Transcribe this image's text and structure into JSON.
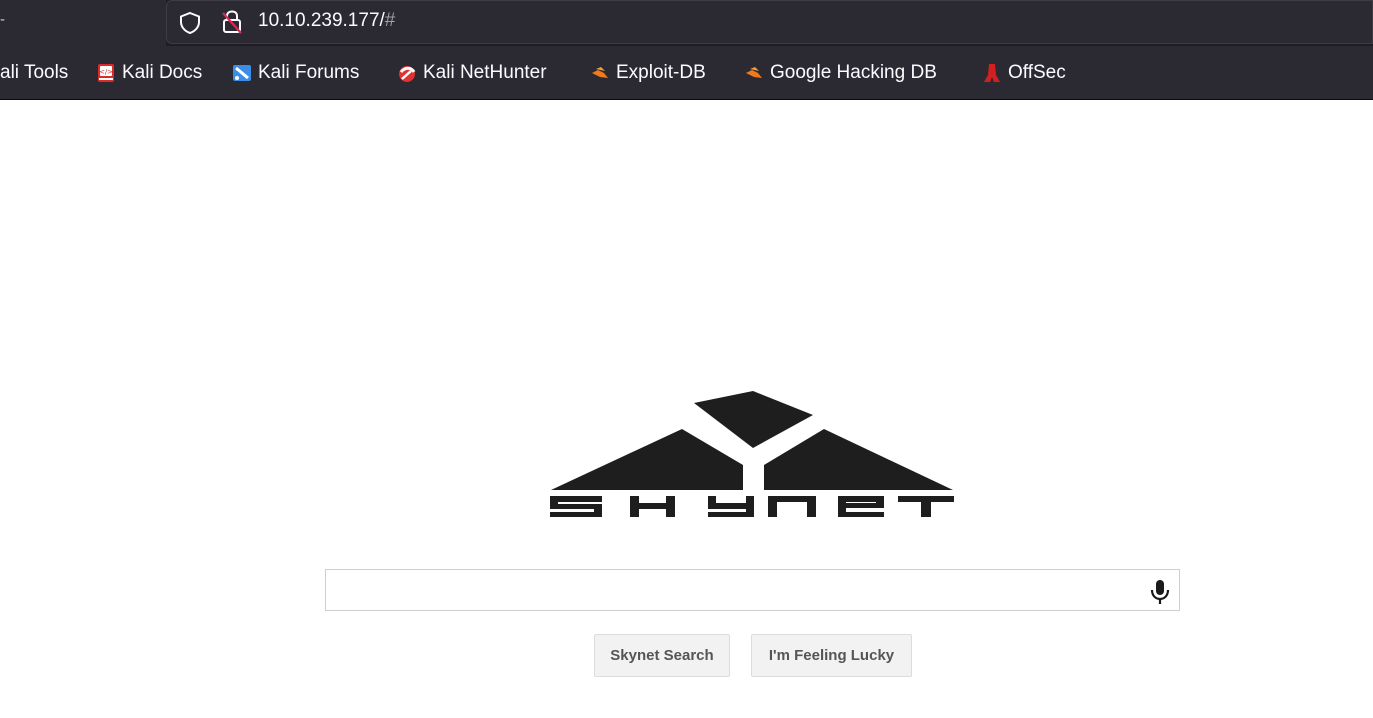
{
  "browser": {
    "tab_fragment": "-",
    "url": {
      "host": "10.10.239.177/",
      "hash": "#"
    },
    "bookmarks": [
      {
        "label": "ali Tools",
        "icon": "kali-tools-icon"
      },
      {
        "label": "Kali Docs",
        "icon": "kali-docs-icon"
      },
      {
        "label": "Kali Forums",
        "icon": "kali-forums-icon"
      },
      {
        "label": "Kali NetHunter",
        "icon": "kali-nethunter-icon"
      },
      {
        "label": "Exploit-DB",
        "icon": "exploit-db-icon"
      },
      {
        "label": "Google Hacking DB",
        "icon": "ghdb-icon"
      },
      {
        "label": "OffSec",
        "icon": "offsec-icon"
      }
    ]
  },
  "page": {
    "logo_text": "skynet",
    "search": {
      "value": "",
      "placeholder": ""
    },
    "buttons": {
      "search": "Skynet Search",
      "lucky": "I'm Feeling Lucky"
    }
  },
  "colors": {
    "chrome_bg": "#2b2a33",
    "chrome_dark": "#1e1e22",
    "logo": "#1e1e1e",
    "button_bg": "#f2f2f2"
  }
}
